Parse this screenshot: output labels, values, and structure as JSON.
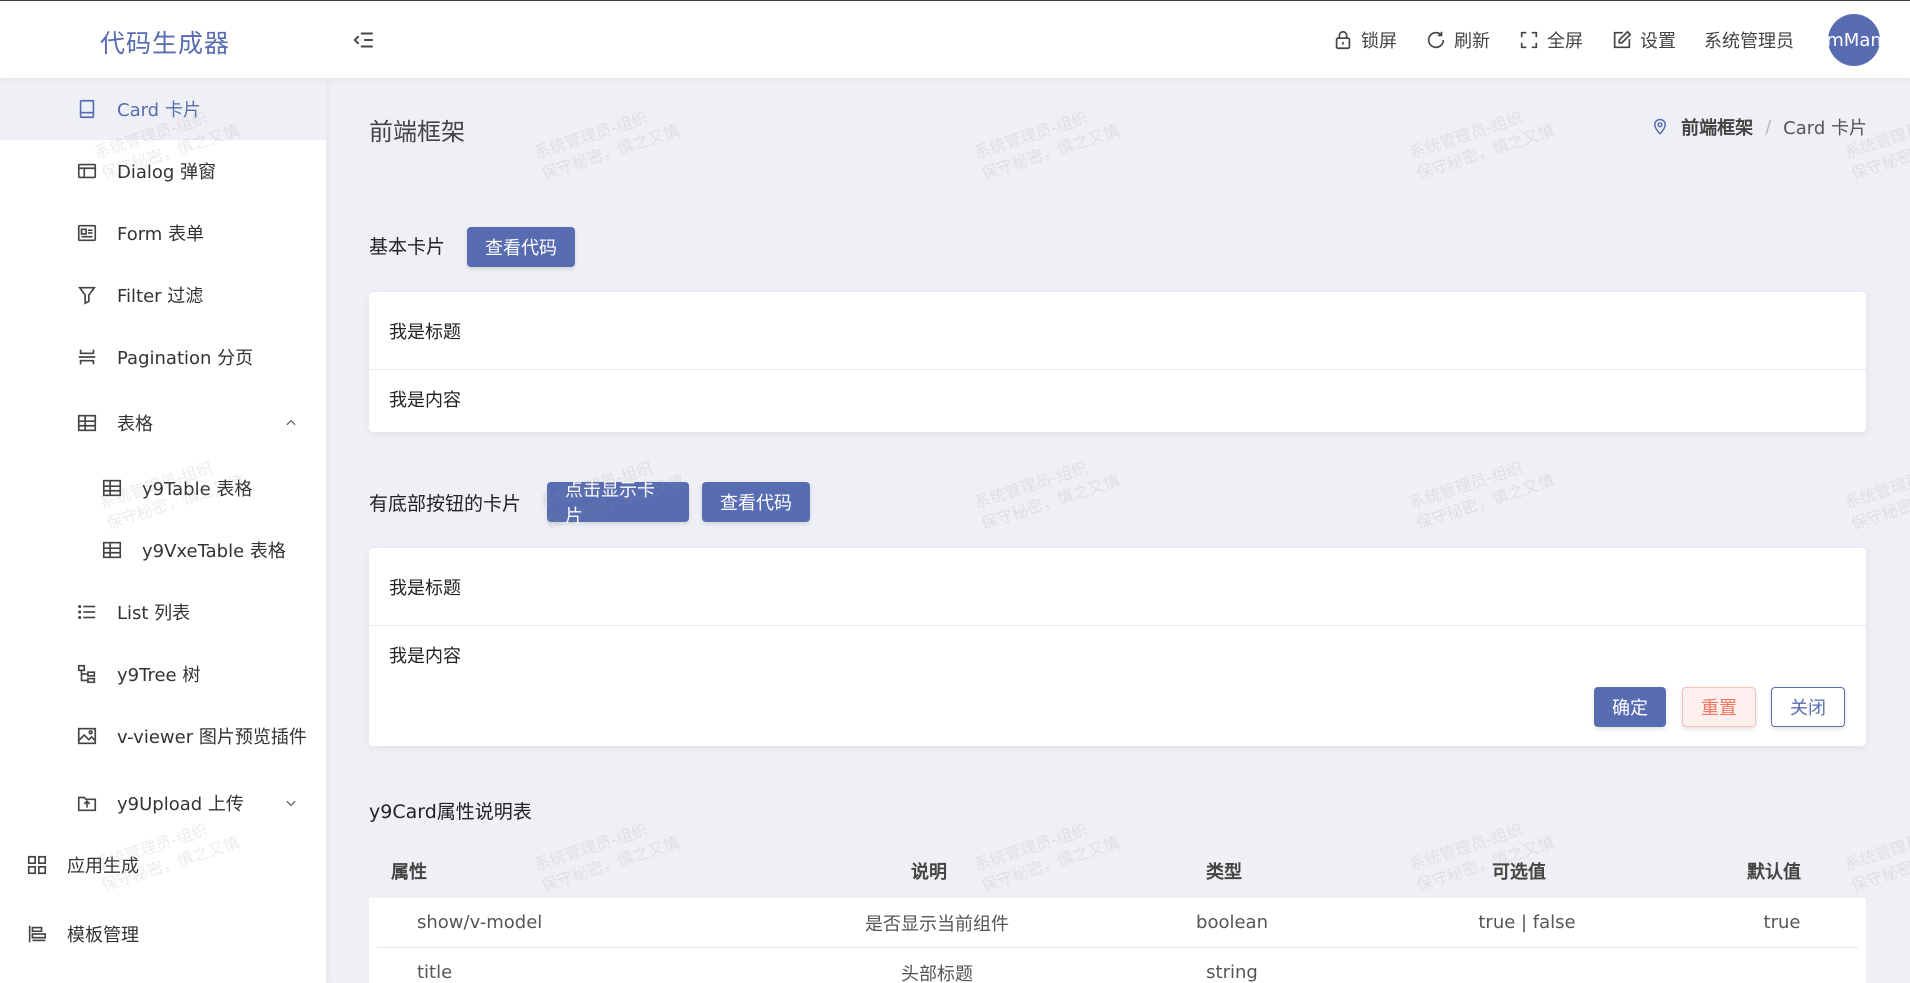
{
  "app": {
    "logo": "代码生成器"
  },
  "topbar": {
    "lock": "锁屏",
    "refresh": "刷新",
    "fullscreen": "全屏",
    "settings": "设置",
    "username": "系统管理员",
    "avatar_text": "mMan"
  },
  "sidebar": {
    "items": [
      {
        "label": "Card 卡片",
        "icon": "card-icon"
      },
      {
        "label": "Dialog 弹窗",
        "icon": "dialog-icon"
      },
      {
        "label": "Form 表单",
        "icon": "form-icon"
      },
      {
        "label": "Filter 过滤",
        "icon": "filter-icon"
      },
      {
        "label": "Pagination 分页",
        "icon": "pagination-icon"
      },
      {
        "label": "表格",
        "icon": "table-icon"
      },
      {
        "label": "y9Table 表格",
        "icon": "table-icon"
      },
      {
        "label": "y9VxeTable 表格",
        "icon": "table-icon"
      },
      {
        "label": "List 列表",
        "icon": "list-icon"
      },
      {
        "label": "y9Tree 树",
        "icon": "tree-icon"
      },
      {
        "label": "v-viewer 图片预览插件",
        "icon": "image-icon"
      },
      {
        "label": "y9Upload 上传",
        "icon": "upload-icon"
      },
      {
        "label": "应用生成",
        "icon": "grid-icon"
      },
      {
        "label": "模板管理",
        "icon": "template-icon"
      }
    ]
  },
  "main": {
    "page_title": "前端框架",
    "breadcrumb": {
      "root": "前端框架",
      "sep": "/",
      "current": "Card 卡片"
    },
    "basic": {
      "title": "基本卡片",
      "view_code": "查看代码",
      "card_title": "我是标题",
      "card_content": "我是内容"
    },
    "footer_card": {
      "title": "有底部按钮的卡片",
      "show_card": "点击显示卡片",
      "view_code": "查看代码",
      "card_title": "我是标题",
      "card_content": "我是内容",
      "confirm": "确定",
      "reset": "重置",
      "close": "关闭"
    },
    "props_table": {
      "title": "y9Card属性说明表",
      "headers": [
        "属性",
        "说明",
        "类型",
        "可选值",
        "默认值"
      ],
      "rows": [
        [
          "show/v-model",
          "是否显示当前组件",
          "boolean",
          "true | false",
          "true"
        ],
        [
          "title",
          "头部标题",
          "string",
          "",
          ""
        ]
      ]
    }
  },
  "watermark": {
    "line1": "系统管理员-组织",
    "line2": "保守秘密，慎之又慎"
  },
  "colors": {
    "primary": "#586cb1",
    "danger": "#f07560",
    "background": "#eef0f6"
  }
}
